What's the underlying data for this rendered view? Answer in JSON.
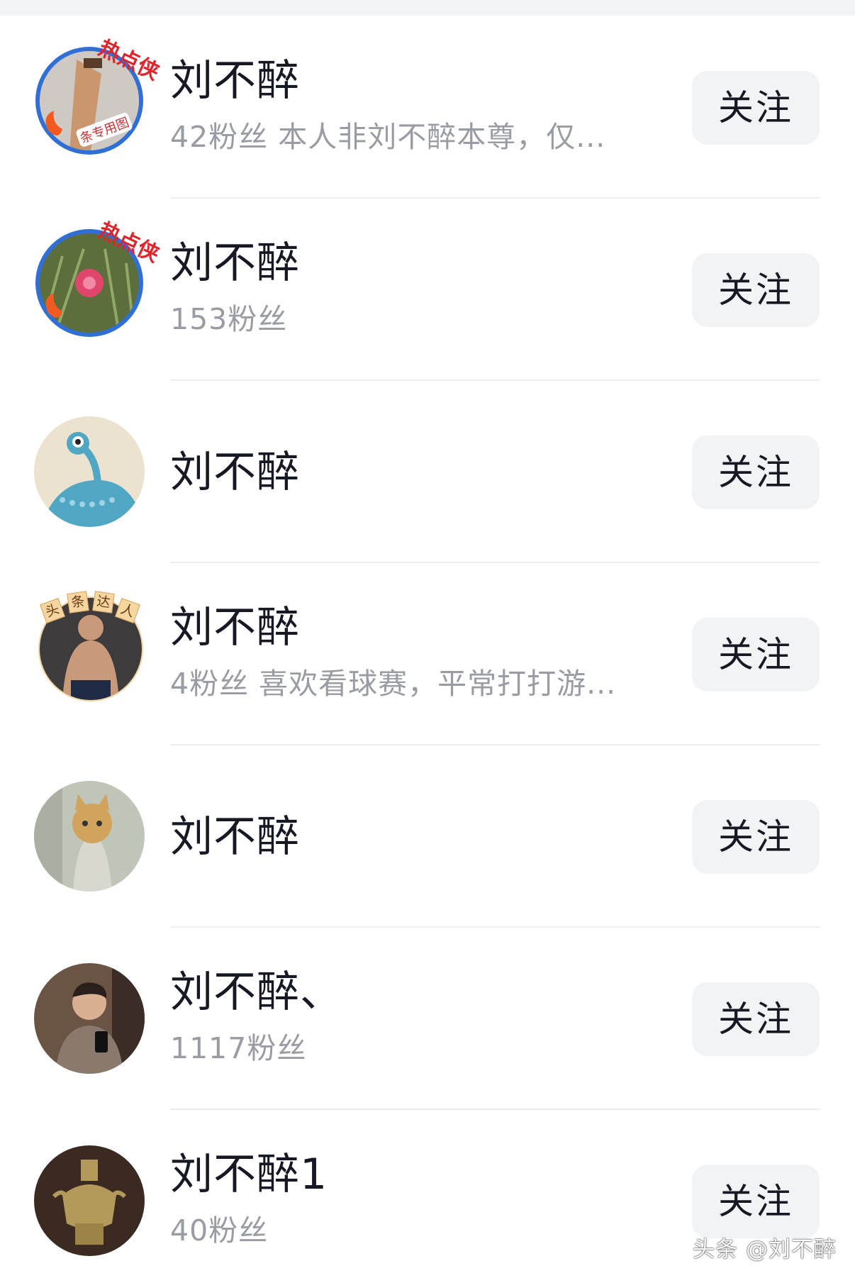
{
  "colors": {
    "name": "#161823",
    "secondary": "#9a9ca3",
    "button_bg": "#f2f3f5",
    "divider": "#eeeff1"
  },
  "users": [
    {
      "name": "刘不醉",
      "subtitle": "42粉丝 本人非刘不醉本尊，仅...",
      "follow_label": "关注",
      "avatar_icon": "hot-badge-avatar-icon",
      "badge": "热点侠",
      "badge_ribbon": "条专用图"
    },
    {
      "name": "刘不醉",
      "subtitle": "153粉丝",
      "follow_label": "关注",
      "avatar_icon": "flower-avatar-icon",
      "badge": "热点侠"
    },
    {
      "name": "刘不醉",
      "subtitle": "",
      "follow_label": "关注",
      "avatar_icon": "alien-avatar-icon"
    },
    {
      "name": "刘不醉",
      "subtitle": "4粉丝 喜欢看球赛，平常打打游...",
      "follow_label": "关注",
      "avatar_icon": "toutiao-daren-avatar-icon",
      "badge_chars": [
        "头",
        "条",
        "达",
        "人"
      ]
    },
    {
      "name": "刘不醉",
      "subtitle": "",
      "follow_label": "关注",
      "avatar_icon": "kitten-avatar-icon"
    },
    {
      "name": "刘不醉、",
      "subtitle": "1117粉丝",
      "follow_label": "关注",
      "avatar_icon": "man-selfie-avatar-icon"
    },
    {
      "name": "刘不醉1",
      "subtitle": "40粉丝",
      "follow_label": "关注",
      "avatar_icon": "bronze-vessel-avatar-icon"
    }
  ],
  "watermark": "头条 @刘不醉"
}
